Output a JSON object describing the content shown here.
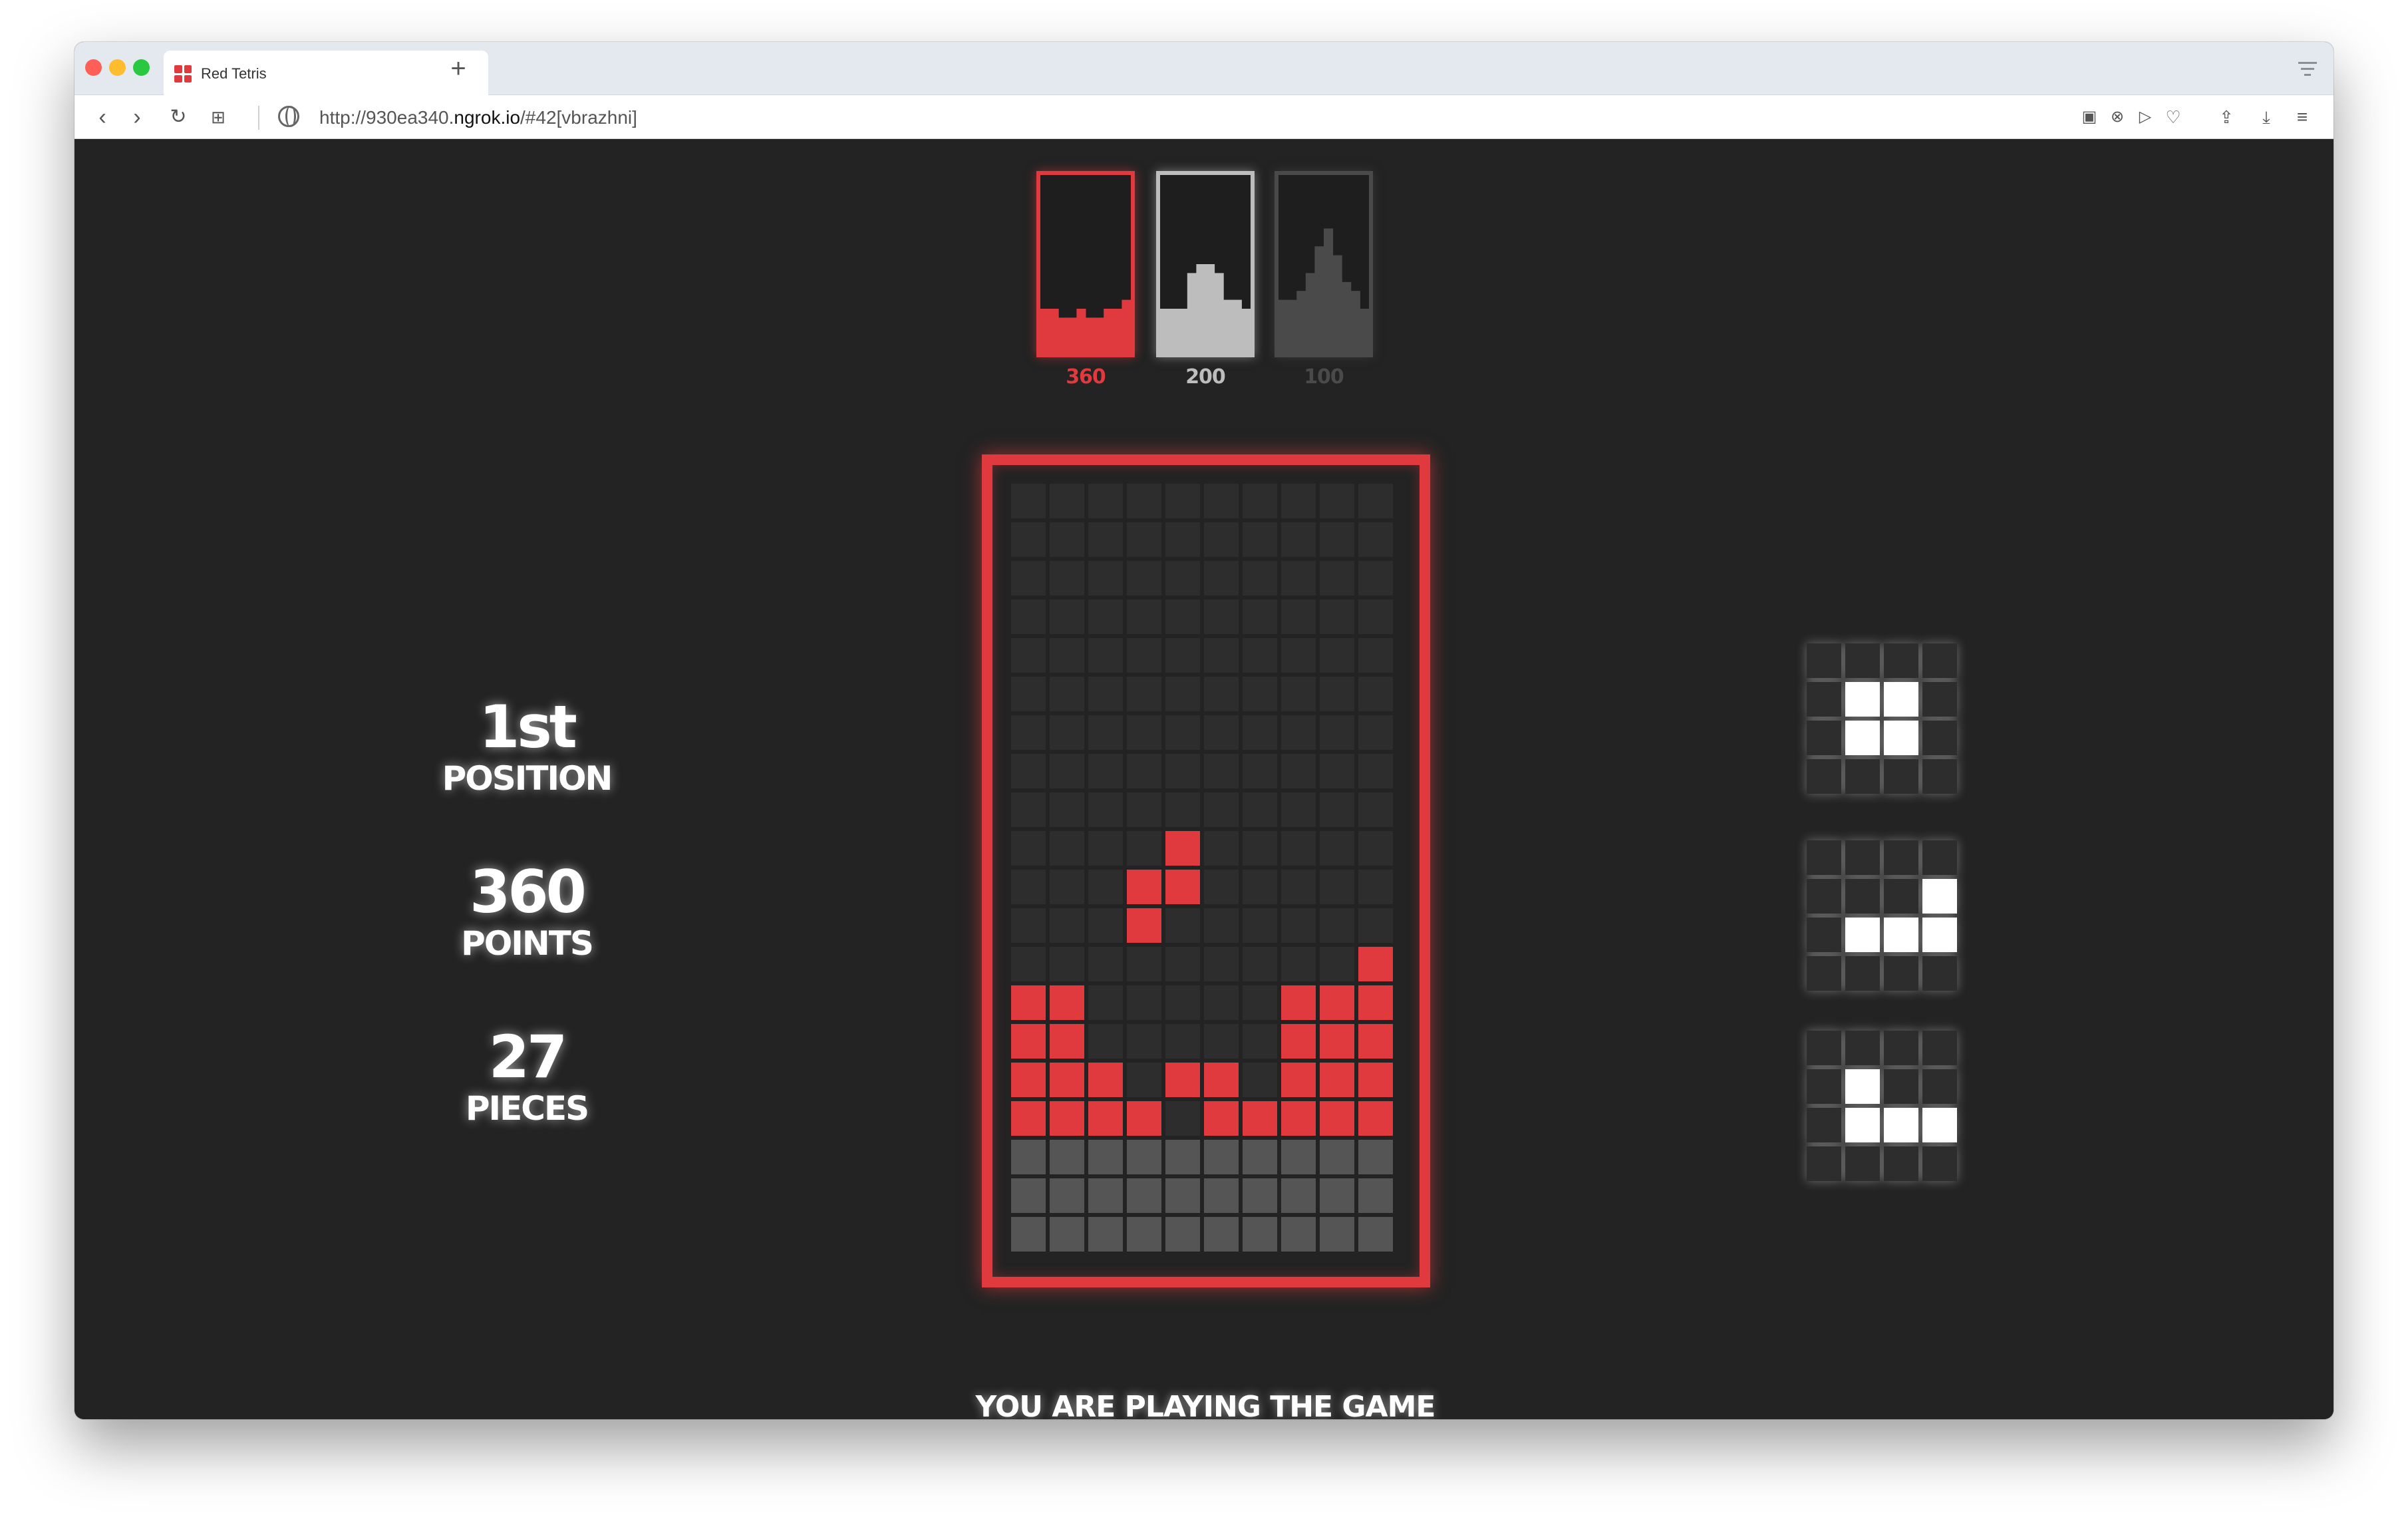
{
  "browser": {
    "tab_title": "Red Tetris",
    "url_prefix": "http://930ea340.",
    "url_domain": "ngrok.io",
    "url_suffix": "/#42[vbrazhni]",
    "new_tab_label": "+"
  },
  "colors": {
    "accent": "#e03a3e",
    "empty_cell": "#2d2d2d",
    "penalty_cell": "#555555",
    "preview_cell": "#ffffff",
    "background": "#232323"
  },
  "opponents": [
    {
      "score": "360",
      "frame_color": "#e03a3e",
      "fill_color": "#e03a3e",
      "column_heights": [
        2,
        2,
        1,
        1,
        2,
        1,
        1,
        2,
        2,
        3
      ]
    },
    {
      "score": "200",
      "frame_color": "#bdbdbd",
      "fill_color": "#bdbdbd",
      "column_heights": [
        2,
        2,
        2,
        6,
        7,
        7,
        6,
        3,
        3,
        2
      ]
    },
    {
      "score": "100",
      "frame_color": "#4a4a4a",
      "fill_color": "#4a4a4a",
      "column_heights": [
        3,
        3,
        4,
        6,
        9,
        11,
        8,
        5,
        4,
        2
      ]
    }
  ],
  "stats": {
    "position_value": "1st",
    "position_label": "POSITION",
    "points_value": "360",
    "points_label": "POINTS",
    "pieces_value": "27",
    "pieces_label": "PIECES"
  },
  "board": {
    "columns": 10,
    "rows": 20,
    "grid": [
      "..........",
      "..........",
      "..........",
      "..........",
      "..........",
      "..........",
      "..........",
      "..........",
      "..........",
      "....R.....",
      "...RR.....",
      "...R......",
      ".........R",
      "RR.....RRR",
      "RR.....RRR",
      "RRR.RR.RRR",
      "RRRR.RRRRR",
      "PPPPPPPPPP",
      "PPPPPPPPPP",
      "PPPPPPPPPP"
    ]
  },
  "next_pieces": [
    {
      "name": "O",
      "grid": [
        "....",
        ".##.",
        ".##.",
        "...."
      ]
    },
    {
      "name": "L",
      "grid": [
        "....",
        "...#",
        ".###",
        "...."
      ]
    },
    {
      "name": "J",
      "grid": [
        "....",
        ".#..",
        ".###",
        "...."
      ]
    }
  ],
  "status_message": "YOU ARE PLAYING THE GAME"
}
